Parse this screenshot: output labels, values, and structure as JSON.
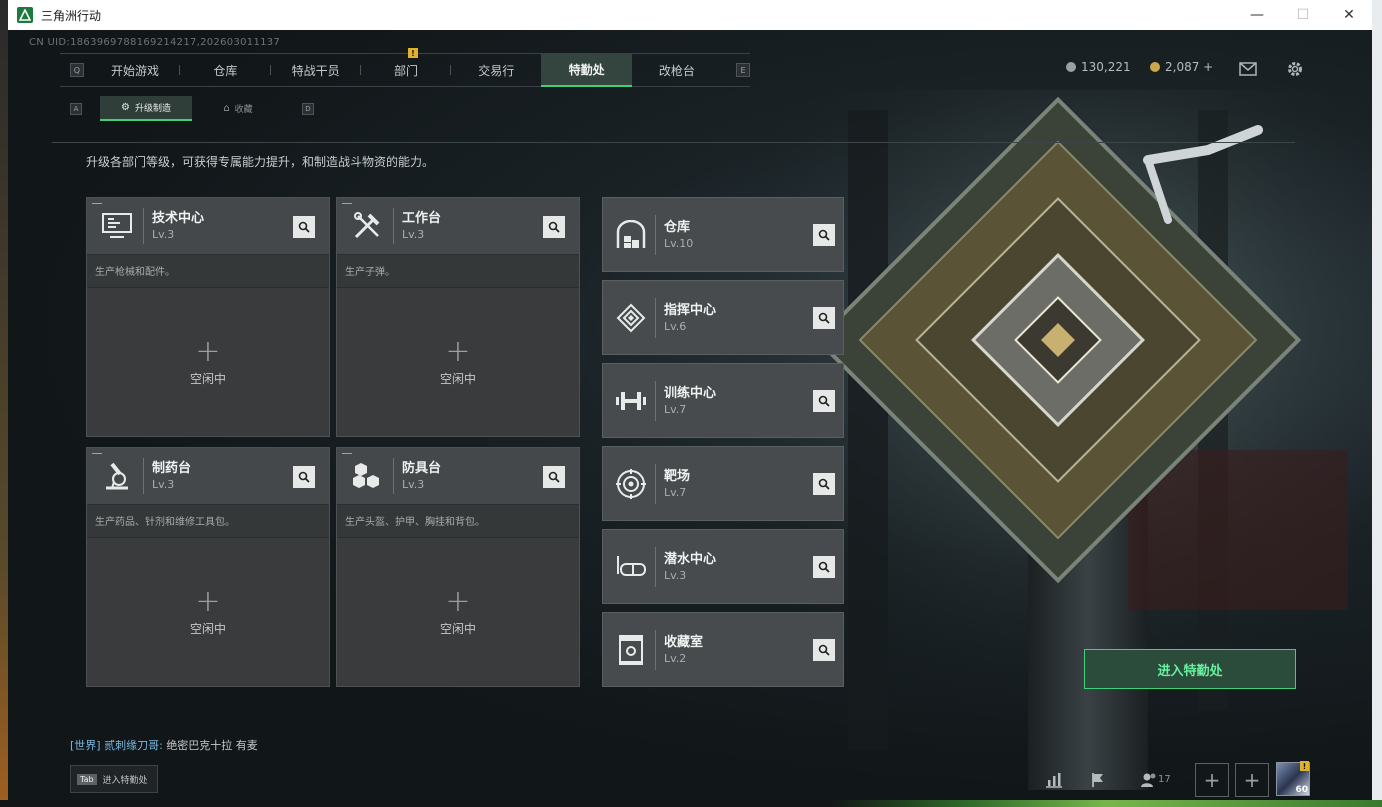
{
  "window": {
    "title": "三角洲行动",
    "minimize": "—",
    "maximize": "☐",
    "close": "✕"
  },
  "uid": "CN UID:186396978816921421​7,202603011137",
  "nav": {
    "key_left": "Q",
    "key_right": "E",
    "tabs": [
      {
        "label": "开始游戏"
      },
      {
        "label": "仓库"
      },
      {
        "label": "特战干员"
      },
      {
        "label": "部门",
        "alert": "!"
      },
      {
        "label": "交易行"
      },
      {
        "label": "特勤处",
        "active": true
      },
      {
        "label": "改枪台"
      }
    ]
  },
  "currency": {
    "silver": "130,221",
    "gold": "2,087 +"
  },
  "subnav": {
    "key_left": "A",
    "key_right": "D",
    "tabs": [
      {
        "label": "升级制造",
        "active": true
      },
      {
        "label": "收藏"
      }
    ]
  },
  "description": "升级各部门等级，可获得专属能力提升，和制造战斗物资的能力。",
  "workbenches": [
    {
      "name": "技术中心",
      "level": "Lv.3",
      "desc": "生产枪械和配件。",
      "status": "空闲中",
      "icon": "computer-icon"
    },
    {
      "name": "工作台",
      "level": "Lv.3",
      "desc": "生产子弹。",
      "status": "空闲中",
      "icon": "tools-icon"
    },
    {
      "name": "制药台",
      "level": "Lv.3",
      "desc": "生产药品、针剂和维修工具包。",
      "status": "空闲中",
      "icon": "microscope-icon"
    },
    {
      "name": "防具台",
      "level": "Lv.3",
      "desc": "生产头盔、护甲、胸挂和背包。",
      "status": "空闲中",
      "icon": "cubes-icon"
    }
  ],
  "departments": [
    {
      "name": "仓库",
      "level": "Lv.10",
      "icon": "warehouse-icon"
    },
    {
      "name": "指挥中心",
      "level": "Lv.6",
      "icon": "chip-icon"
    },
    {
      "name": "训练中心",
      "level": "Lv.7",
      "icon": "dumbbell-icon"
    },
    {
      "name": "靶场",
      "level": "Lv.7",
      "icon": "target-icon"
    },
    {
      "name": "潜水中心",
      "level": "Lv.3",
      "icon": "diving-mask-icon"
    },
    {
      "name": "收藏室",
      "level": "Lv.2",
      "icon": "trophy-case-icon"
    }
  ],
  "enter_button": "进入特勤处",
  "chat": {
    "channel": "[世界]",
    "sender": "贰刺缘刀哥:",
    "message": "绝密巴克十拉 有麦"
  },
  "tab_hint": {
    "key": "Tab",
    "label": "进入特勤处"
  },
  "bottom_bar": {
    "friend_count": "17",
    "avatar_level": "60",
    "avatar_alert": "!"
  }
}
